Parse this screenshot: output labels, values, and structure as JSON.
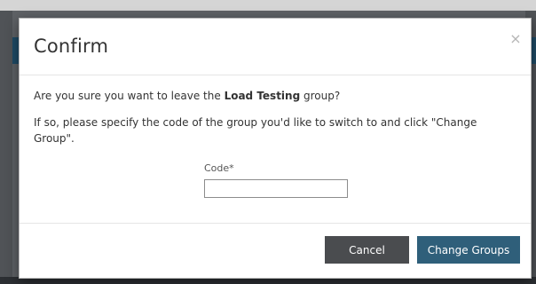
{
  "dialog": {
    "title": "Confirm",
    "close_glyph": "×",
    "message_prefix": "Are you sure you want to leave the ",
    "group_name": "Load Testing",
    "message_suffix": " group?",
    "instruction": "If so, please specify the code of the group you'd like to switch to and click \"Change Group\".",
    "code_label": "Code*",
    "code_value": "",
    "cancel_label": "Cancel",
    "submit_label": "Change Groups"
  },
  "colors": {
    "cancel_button": "#4a4c4f",
    "submit_button": "#2f5f7a",
    "header_accent": "#1f4b66"
  }
}
